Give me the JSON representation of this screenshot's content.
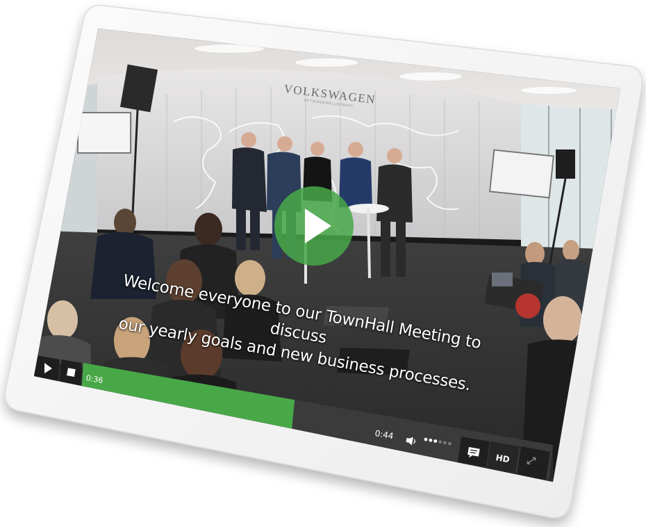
{
  "brand_sign": "VOLKSWAGEN",
  "brand_sub": "AKTIENGESELLSCHAFT",
  "subtitle": {
    "line1": "Welcome everyone to our TownHall Meeting to discuss",
    "line2": "our yearly goals and new business processes."
  },
  "player": {
    "elapsed": "0:36",
    "duration": "0:44",
    "progress_fraction": 0.45,
    "volume_level": 3,
    "volume_steps": 6,
    "hd_label": "HD"
  },
  "colors": {
    "accent_green": "#48A848",
    "control_dark": "#222222"
  },
  "icons": [
    "play-icon",
    "stop-icon",
    "volume-icon",
    "captions-icon",
    "fullscreen-icon"
  ]
}
